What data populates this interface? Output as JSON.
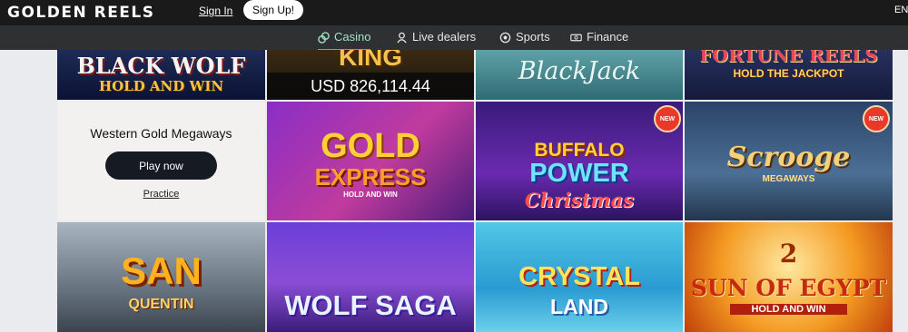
{
  "header": {
    "logo": "GOLDEN REELS",
    "sign_in": "Sign In",
    "sign_up": "Sign Up!",
    "lang": "EN"
  },
  "nav": {
    "items": [
      {
        "label": "Casino",
        "icon": "chips-icon",
        "active": true
      },
      {
        "label": "Live dealers",
        "icon": "dealer-icon"
      },
      {
        "label": "Sports",
        "icon": "ball-icon"
      },
      {
        "label": "Finance",
        "icon": "cash-icon"
      }
    ]
  },
  "games": {
    "row1": [
      {
        "title": "BLACK WOLF",
        "subtitle": "HOLD AND WIN"
      },
      {
        "title": "KING",
        "jackpot": "USD 826,114.44"
      },
      {
        "title": "BlackJack"
      },
      {
        "title": "FORTUNE REELS",
        "subtitle": "HOLD THE JACKPOT"
      }
    ],
    "featured": {
      "title": "Western Gold Megaways",
      "play": "Play now",
      "practice": "Practice"
    },
    "row2": [
      {
        "title1": "GOLD",
        "title2": "EXPRESS",
        "subtitle": "HOLD AND WIN"
      },
      {
        "title1": "BUFFALO",
        "title2": "POWER",
        "subtitle": "Christmas",
        "badge": "NEW"
      },
      {
        "title1": "Scrooge",
        "subtitle": "MEGAWAYS",
        "badge": "NEW"
      }
    ],
    "row3": [
      {
        "title1": "SAN",
        "title2": "QUENTIN"
      },
      {
        "title1": "WOLF SAGA"
      },
      {
        "title1": "CRYSTAL",
        "title2": "LAND"
      },
      {
        "title0": "2",
        "title1": "SUN OF EGYPT",
        "subtitle": "HOLD AND WIN"
      }
    ]
  }
}
